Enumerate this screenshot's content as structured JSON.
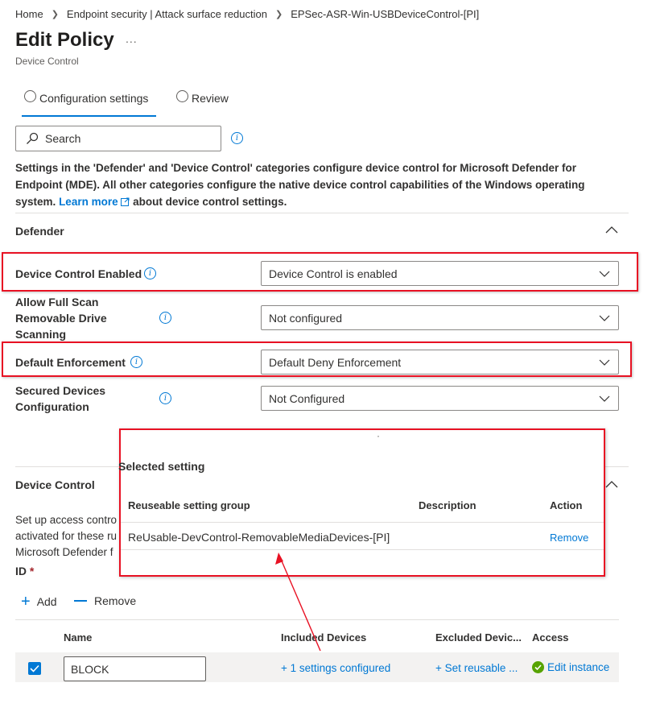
{
  "breadcrumb": {
    "items": [
      "Home",
      "Endpoint security | Attack surface reduction",
      "EPSec-ASR-Win-USBDeviceControl-[PI]"
    ]
  },
  "page": {
    "title": "Edit Policy",
    "ellipsis": "...",
    "subtitle": "Device Control"
  },
  "tabs": [
    {
      "label": "Configuration settings",
      "selected": true
    },
    {
      "label": "Review",
      "selected": false
    }
  ],
  "search": {
    "placeholder": "Search"
  },
  "description": {
    "text_before": "Settings in the 'Defender' and 'Device Control' categories configure device control for Microsoft Defender for Endpoint (MDE). All other categories configure the native device control capabilities of the Windows operating system.",
    "link": "Learn more",
    "text_after": "about device control settings."
  },
  "defender": {
    "title": "Defender",
    "settings": [
      {
        "label": "Device Control Enabled",
        "value": "Device Control is enabled"
      },
      {
        "label": "Allow Full Scan Removable Drive Scanning",
        "value": "Not configured"
      },
      {
        "label": "Default Enforcement",
        "value": "Default Deny Enforcement"
      },
      {
        "label": "Secured Devices Configuration",
        "value": "Not Configured"
      }
    ]
  },
  "device_control": {
    "title": "Device Control",
    "desc_lines": [
      "Set up access contro",
      "activated for these ru",
      "Microsoft Defender f"
    ],
    "id_label": "ID",
    "required_mark": "*",
    "add_label": "Add",
    "remove_label": "Remove",
    "columns": [
      "Name",
      "Included Devices",
      "Excluded Devic...",
      "Access"
    ],
    "row": {
      "name": "BLOCK",
      "included": "+ 1 settings configured",
      "excluded": "+ Set reusable ...",
      "access": "Edit instance"
    }
  },
  "popup": {
    "dot": "·",
    "title": "Selected setting",
    "columns": [
      "Reuseable setting group",
      "Description",
      "Action"
    ],
    "row": {
      "group": "ReUsable-DevControl-RemovableMediaDevices-[PI]",
      "description": "",
      "action": "Remove"
    }
  },
  "colors": {
    "accent": "#0078d4",
    "annotation_red": "#e81123",
    "success": "#57a300"
  }
}
